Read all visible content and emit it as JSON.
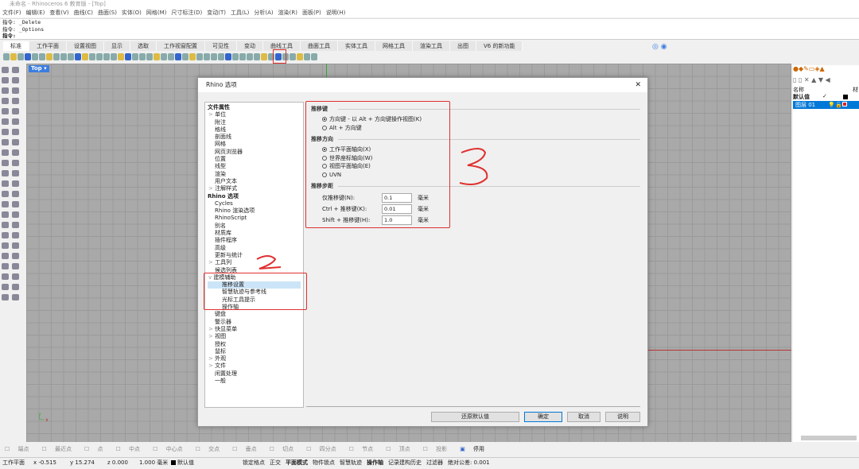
{
  "window": {
    "title": "未命名 - Rhinoceros 6 教育版 - [Top]"
  },
  "menu": [
    "文件(F)",
    "编辑(E)",
    "查看(V)",
    "曲线(C)",
    "曲面(S)",
    "实体(O)",
    "网格(M)",
    "尺寸标注(D)",
    "变动(T)",
    "工具(L)",
    "分析(A)",
    "渲染(R)",
    "面板(P)",
    "说明(H)"
  ],
  "command": {
    "history": [
      "指令: _Delete",
      "指令: _Options"
    ],
    "prompt": "指令:"
  },
  "tabs": [
    "标准",
    "工作平面",
    "设置视图",
    "显示",
    "选取",
    "工作视窗配置",
    "可见性",
    "变动",
    "曲线工具",
    "曲面工具",
    "实体工具",
    "网格工具",
    "渲染工具",
    "出图",
    "V6 的新功能"
  ],
  "viewport": {
    "label": "Top ▾"
  },
  "layers": {
    "header": "名称",
    "header2": "材",
    "rows": [
      {
        "name": "默认值",
        "check": "✓"
      },
      {
        "name": "图层 01",
        "selected": true
      }
    ]
  },
  "dialog": {
    "title": "Rhino 选项",
    "tree": [
      {
        "t": "文件属性",
        "b": true
      },
      {
        "t": "单位",
        "e": ">",
        "i": 1
      },
      {
        "t": "附注",
        "i": 1
      },
      {
        "t": "格线",
        "i": 1
      },
      {
        "t": "剖面线",
        "i": 1
      },
      {
        "t": "网格",
        "i": 1
      },
      {
        "t": "网页浏览器",
        "i": 1
      },
      {
        "t": "位置",
        "i": 1
      },
      {
        "t": "线型",
        "i": 1
      },
      {
        "t": "渲染",
        "i": 1
      },
      {
        "t": "用户文本",
        "i": 1
      },
      {
        "t": "注解样式",
        "e": ">",
        "i": 1
      },
      {
        "t": "Rhino 选项",
        "b": true
      },
      {
        "t": "Cycles",
        "i": 1
      },
      {
        "t": "Rhino 渲染选项",
        "i": 1
      },
      {
        "t": "RhinoScript",
        "i": 1
      },
      {
        "t": "别名",
        "i": 1
      },
      {
        "t": "材质库",
        "i": 1
      },
      {
        "t": "插件程序",
        "i": 1
      },
      {
        "t": "高级",
        "i": 1
      },
      {
        "t": "更新与统计",
        "i": 1
      },
      {
        "t": "工具列",
        "e": ">",
        "i": 1
      },
      {
        "t": "候选列表",
        "i": 1
      },
      {
        "t": "建模辅助",
        "e": "v",
        "i": 1
      },
      {
        "t": "推移设置",
        "i": 2,
        "sel": true
      },
      {
        "t": "智慧轨迹与参考线",
        "i": 2
      },
      {
        "t": "光标工具提示",
        "i": 2
      },
      {
        "t": "操作轴",
        "i": 2
      },
      {
        "t": "键盘",
        "i": 1
      },
      {
        "t": "警示器",
        "i": 1
      },
      {
        "t": "快显菜单",
        "e": ">",
        "i": 1
      },
      {
        "t": "视图",
        "e": ">",
        "i": 1
      },
      {
        "t": "授权",
        "i": 1
      },
      {
        "t": "鼠标",
        "i": 1
      },
      {
        "t": "外观",
        "e": ">",
        "i": 1
      },
      {
        "t": "文件",
        "e": ">",
        "i": 1
      },
      {
        "t": "闲置处理",
        "i": 1
      },
      {
        "t": "一般",
        "i": 1
      }
    ],
    "nudge_keys": {
      "title": "推移键",
      "options": [
        {
          "label": "方向键 - 以 Alt + 方向键操作视图(K)",
          "on": true
        },
        {
          "label": "Alt + 方向键",
          "on": false
        }
      ]
    },
    "nudge_dir": {
      "title": "推移方向",
      "options": [
        {
          "label": "工作平面轴向(X)",
          "on": true
        },
        {
          "label": "世界座标轴向(W)",
          "on": false
        },
        {
          "label": "视图平面轴向(E)",
          "on": false
        },
        {
          "label": "UVN",
          "on": false
        }
      ]
    },
    "nudge_step": {
      "title": "推移步距",
      "rows": [
        {
          "label": "仅推移键(N):",
          "value": "0.1",
          "unit": "毫米"
        },
        {
          "label": "Ctrl + 推移键(K):",
          "value": "0.01",
          "unit": "毫米"
        },
        {
          "label": "Shift + 推移键(H):",
          "value": "1.0",
          "unit": "毫米"
        }
      ]
    },
    "buttons": {
      "restore": "还原默认值",
      "ok": "确定",
      "cancel": "取消",
      "help": "说明"
    }
  },
  "snaps": [
    "端点",
    "最近点",
    "点",
    "中点",
    "中心点",
    "交点",
    "垂点",
    "切点",
    "四分点",
    "节点",
    "顶点",
    "投影",
    "停用"
  ],
  "status": {
    "cplane": "工作平面",
    "x": "x -0.515",
    "y": "y 15.274",
    "z": "z 0.000",
    "units": "1.000 毫米",
    "layer": "默认值",
    "toggles": [
      "锁定格点",
      "正交",
      "平面模式",
      "物件锁点",
      "智慧轨迹",
      "操作轴",
      "记录建构历史",
      "过滤器",
      "绝对公差: 0.001"
    ]
  },
  "annotations": {
    "color": "#e03030",
    "numbers": [
      "3",
      "2"
    ]
  }
}
